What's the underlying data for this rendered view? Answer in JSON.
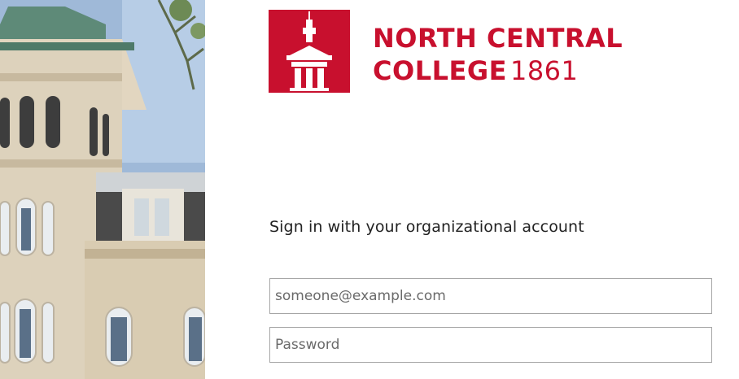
{
  "branding": {
    "name_line1": "NORTH CENTRAL",
    "name_line2": "COLLEGE",
    "year": "1861",
    "brand_color": "#c8102e"
  },
  "signin": {
    "heading": "Sign in with your organizational account",
    "username": {
      "value": "",
      "placeholder": "someone@example.com"
    },
    "password": {
      "value": "",
      "placeholder": "Password"
    }
  },
  "illustration": {
    "subject": "campus-building-photo"
  }
}
